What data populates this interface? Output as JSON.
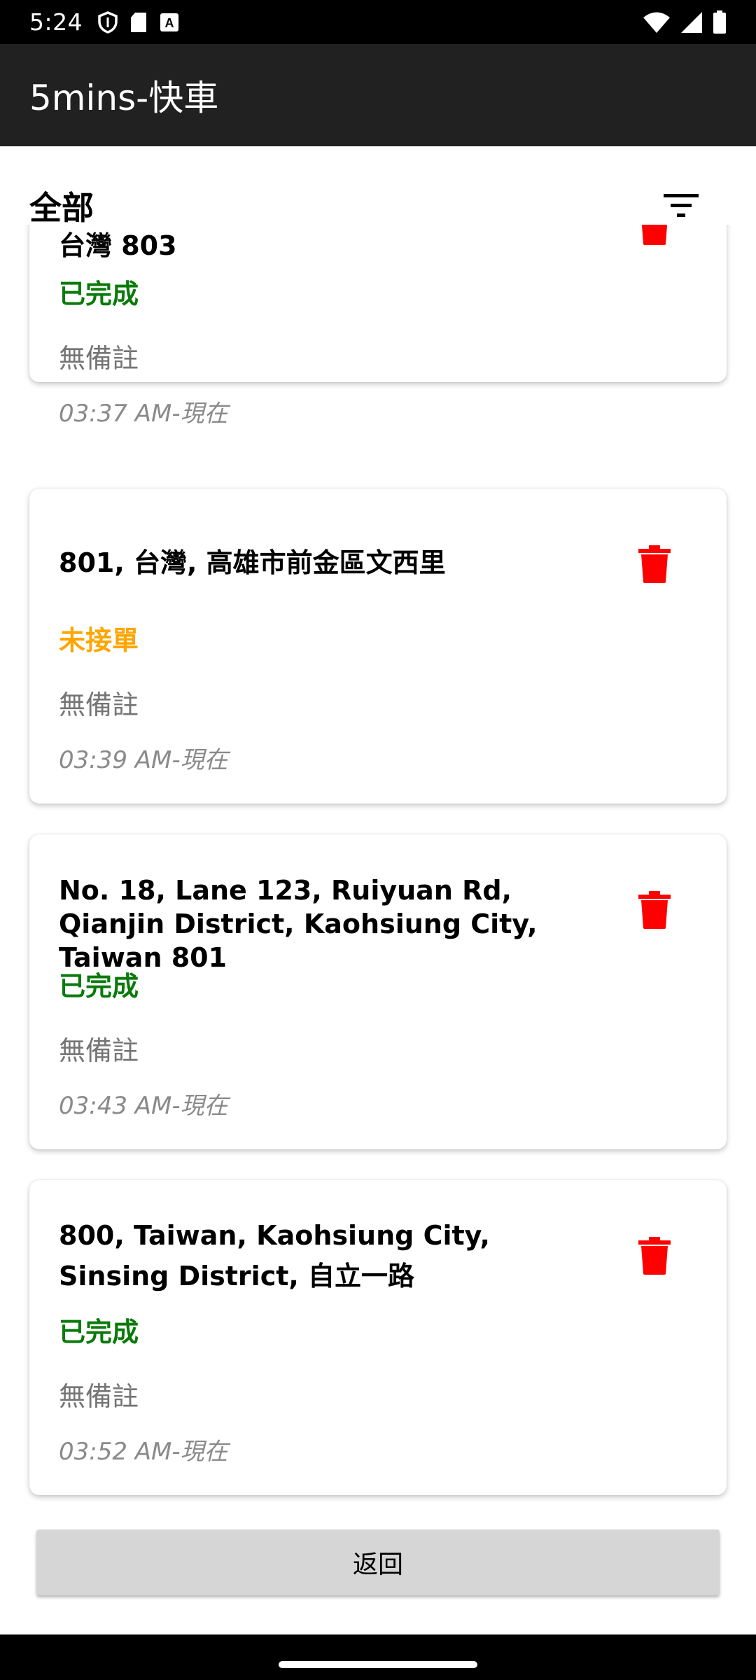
{
  "status_bar": {
    "time": "5:24",
    "left_icons": [
      "shield-icon",
      "sd-card-icon",
      "a-badge-icon"
    ],
    "right_icons": [
      "wifi-icon",
      "signal-icon",
      "battery-icon"
    ]
  },
  "app_bar": {
    "title": "5mins-快車"
  },
  "filter": {
    "label": "全部",
    "icon": "filter-list-icon"
  },
  "orders": [
    {
      "address": "台灣 803",
      "status": "已完成",
      "status_color": "#0a7a0a",
      "note": "無備註",
      "time": "03:37 AM-現在"
    },
    {
      "address": "801, 台灣, 高雄市前金區文西里",
      "status": "未接單",
      "status_color": "#ffa500",
      "note": "無備註",
      "time": "03:39 AM-現在"
    },
    {
      "address": "No. 18, Lane 123, Ruiyuan Rd, Qianjin District, Kaohsiung City, Taiwan 801",
      "status": "已完成",
      "status_color": "#0a7a0a",
      "note": "無備註",
      "time": "03:43 AM-現在"
    },
    {
      "address": "800, Taiwan, Kaohsiung City, Sinsing District, 自立一路",
      "status": "已完成",
      "status_color": "#0a7a0a",
      "note": "無備註",
      "time": "03:52 AM-現在"
    }
  ],
  "delete_icon": "trash-icon",
  "delete_color": "#ff0000",
  "back_button": {
    "label": "返回"
  }
}
